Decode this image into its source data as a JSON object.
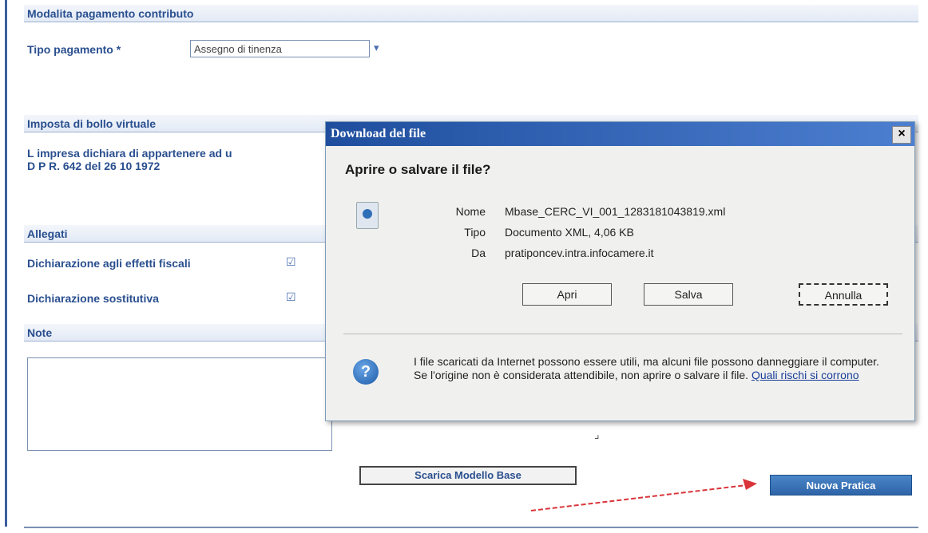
{
  "form": {
    "sections": {
      "payment_title": "Modalita pagamento contributo",
      "stamp_title": "Imposta di bollo virtuale",
      "attachments_title": "Allegati",
      "notes_title": "Note"
    },
    "payment_type_label": "Tipo pagamento *",
    "payment_type_value": "Assegno di tinenza",
    "stamp_text_line1": "L impresa dichiara di appartenere ad u",
    "stamp_text_line2": "D P R. 642 del 26 10 1972",
    "attachments": [
      {
        "label": "Dichiarazione agli effetti fiscali"
      },
      {
        "label": "Dichiarazione sostitutiva"
      }
    ],
    "download_model_button": "Scarica Modello Base",
    "new_practice_button": "Nuova Pratica"
  },
  "dialog": {
    "title": "Download del file",
    "close_glyph": "×",
    "question": "Aprire o salvare il file?",
    "name_key": "Nome",
    "name_value": "Mbase_CERC_VI_001_1283181043819.xml",
    "type_key": "Tipo",
    "type_value": "Documento XML, 4,06 KB",
    "from_key": "Da",
    "from_value": "pratiponcev.intra.infocamere.it",
    "open_button": "Apri",
    "save_button": "Salva",
    "cancel_button": "Annulla",
    "warning_text": "I file scaricati da Internet possono essere utili, ma alcuni file possono danneggiare il computer. Se l'origine non è considerata attendibile, non aprire o salvare il file. ",
    "warning_link": "Quali rischi si corrono"
  },
  "colors": {
    "accent": "#2a4f8f",
    "titlebar": "#1f4e9e",
    "primary_button": "#2e64a8",
    "annotation_arrow": "#d9343a"
  }
}
